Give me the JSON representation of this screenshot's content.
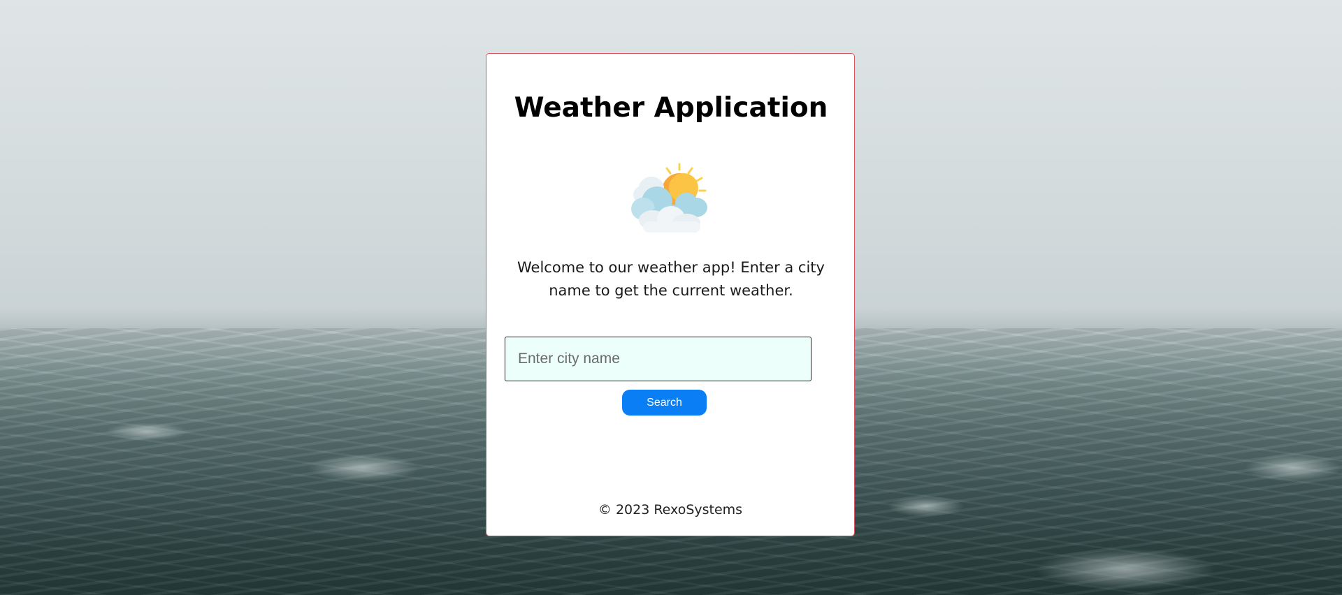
{
  "app": {
    "title": "Weather Application",
    "icon": "sun-behind-clouds-icon",
    "welcome_text": "Welcome to our weather app! Enter a city name to get the current weather."
  },
  "search": {
    "value": "",
    "placeholder": "Enter city name",
    "button_label": "Search"
  },
  "footer": {
    "text": "© 2023 RexoSystems"
  },
  "colors": {
    "accent": "#0a7ef5",
    "card_border": "#d8545a",
    "input_background": "#ecfffb",
    "sun": "#fbbf3c",
    "cloud": "#a9d7e6"
  }
}
